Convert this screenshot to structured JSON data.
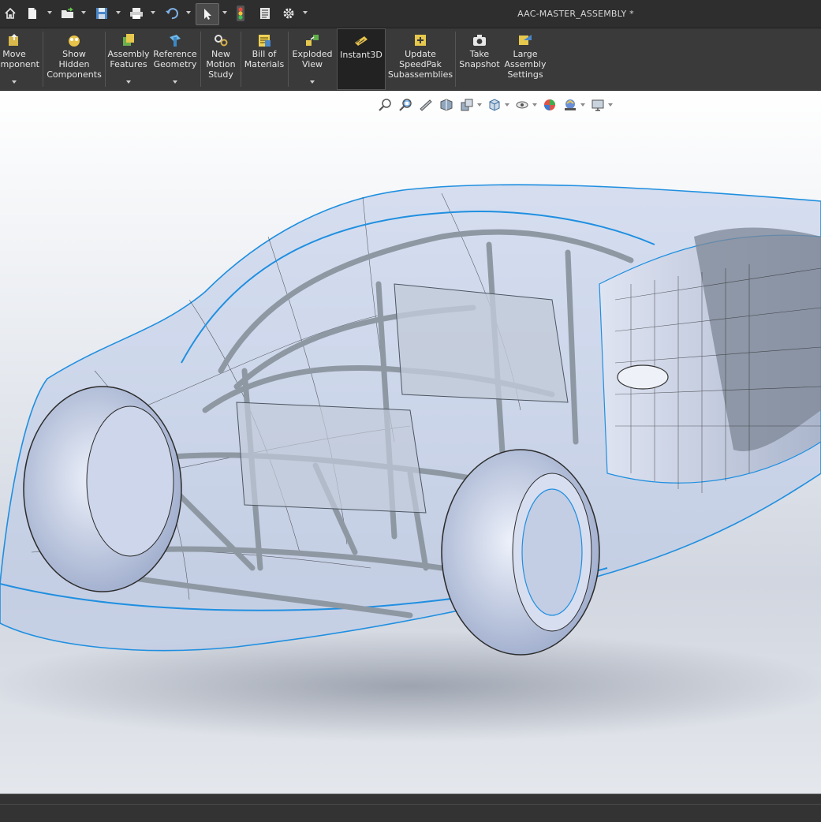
{
  "window": {
    "title": "AAC-MASTER_ASSEMBLY *"
  },
  "quick_access": [
    {
      "name": "home-icon"
    },
    {
      "name": "new-document-icon"
    },
    {
      "name": "open-icon"
    },
    {
      "name": "save-icon"
    },
    {
      "name": "print-icon"
    },
    {
      "name": "undo-icon"
    },
    {
      "name": "select-arrow-icon"
    },
    {
      "name": "rebuild-traffic-light-icon"
    },
    {
      "name": "file-properties-icon"
    },
    {
      "name": "options-gear-icon"
    }
  ],
  "ribbon": {
    "move_component": "Move\nComponent",
    "show_hidden": "Show\nHidden\nComponents",
    "assembly_features": "Assembly\nFeatures",
    "reference_geometry": "Reference\nGeometry",
    "new_motion_study": "New\nMotion\nStudy",
    "bill_of_materials": "Bill of\nMaterials",
    "exploded_view": "Exploded\nView",
    "instant3d": "Instant3D",
    "update_speedpak": "Update\nSpeedPak\nSubassemblies",
    "take_snapshot": "Take\nSnapshot",
    "large_assembly": "Large\nAssembly\nSettings"
  },
  "heads_up_toolbar": [
    {
      "name": "zoom-to-fit-icon"
    },
    {
      "name": "zoom-to-area-icon"
    },
    {
      "name": "previous-view-icon"
    },
    {
      "name": "section-view-icon"
    },
    {
      "name": "dynamic-annotation-icon"
    },
    {
      "name": "view-orientation-icon"
    },
    {
      "name": "display-style-icon"
    },
    {
      "name": "hide-show-items-icon"
    },
    {
      "name": "edit-appearance-icon"
    },
    {
      "name": "apply-scene-icon"
    },
    {
      "name": "view-settings-icon"
    }
  ],
  "colors": {
    "ui_dark": "#2e2e2e",
    "ribbon": "#3a3a3a",
    "wire_blue": "#1f8fe0",
    "body_tint": "#b7c7e6",
    "frame_gray": "#9aa3ad"
  }
}
